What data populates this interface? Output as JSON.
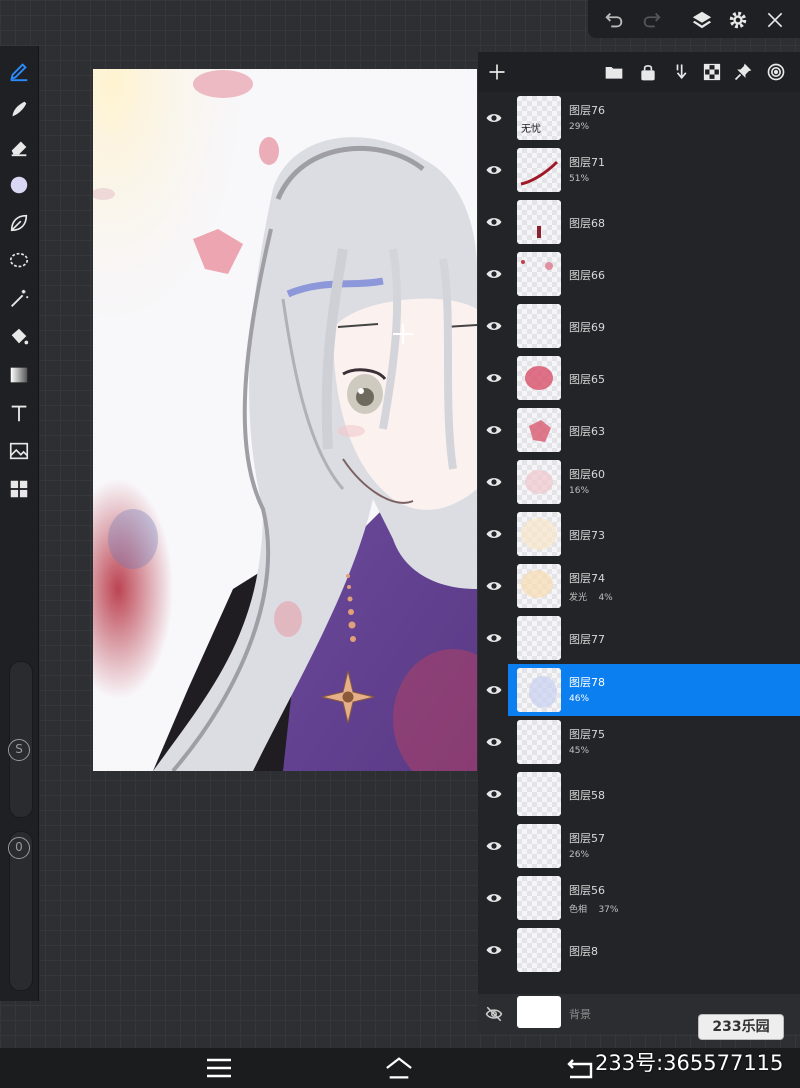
{
  "app": {
    "accent": "#0b7ef0",
    "panel_bg": "#232427"
  },
  "toolbar_left": {
    "tools": [
      {
        "name": "pen-tool-icon",
        "active": true
      },
      {
        "name": "smudge-tool-icon"
      },
      {
        "name": "eraser-tool-icon"
      },
      {
        "name": "color-circle-icon"
      },
      {
        "name": "leaf-brush-icon"
      },
      {
        "name": "lasso-select-icon"
      },
      {
        "name": "magic-wand-icon"
      },
      {
        "name": "paint-bucket-icon"
      },
      {
        "name": "gradient-icon"
      },
      {
        "name": "text-tool-icon"
      },
      {
        "name": "image-import-icon"
      },
      {
        "name": "grid-tools-icon"
      }
    ],
    "size_knob_label": "S",
    "opacity_knob_label": "0"
  },
  "toolbar_top": {
    "icons": [
      "undo-icon",
      "redo-icon",
      "layers-icon",
      "gear-icon",
      "close-icon"
    ]
  },
  "layers_panel": {
    "header_icons": [
      "add-layer-icon",
      "folder-icon",
      "lock-icon",
      "merge-down-icon",
      "checkerboard-icon",
      "pin-icon",
      "target-icon"
    ],
    "layers": [
      {
        "name": "图层76",
        "sub": "29%",
        "thumb_text": "无忧",
        "visible": true
      },
      {
        "name": "图层71",
        "sub": "51%",
        "visible": true
      },
      {
        "name": "图层68",
        "sub": "",
        "visible": true
      },
      {
        "name": "图层66",
        "sub": "",
        "visible": true
      },
      {
        "name": "图层69",
        "sub": "",
        "visible": true
      },
      {
        "name": "图层65",
        "sub": "",
        "visible": true
      },
      {
        "name": "图层63",
        "sub": "",
        "visible": true
      },
      {
        "name": "图层60",
        "sub": "16%",
        "visible": true
      },
      {
        "name": "图层73",
        "sub": "",
        "visible": true
      },
      {
        "name": "图层74",
        "sub": "发光    4%",
        "visible": true
      },
      {
        "name": "图层77",
        "sub": "",
        "visible": true
      },
      {
        "name": "图层78",
        "sub": "46%",
        "visible": true,
        "selected": true
      },
      {
        "name": "图层75",
        "sub": "45%",
        "visible": true
      },
      {
        "name": "图层58",
        "sub": "",
        "visible": true
      },
      {
        "name": "图层57",
        "sub": "26%",
        "visible": true
      },
      {
        "name": "图层56",
        "sub": "色相    37%",
        "visible": true
      },
      {
        "name": "图层8",
        "sub": "",
        "visible": true
      }
    ],
    "background_layer": {
      "name": "背景",
      "visible": false
    }
  },
  "navbar": {
    "icons": [
      "menu-icon",
      "home-icon",
      "back-icon"
    ]
  },
  "watermark": {
    "id_text": "233号:365577115",
    "logo_text": "233乐园"
  }
}
